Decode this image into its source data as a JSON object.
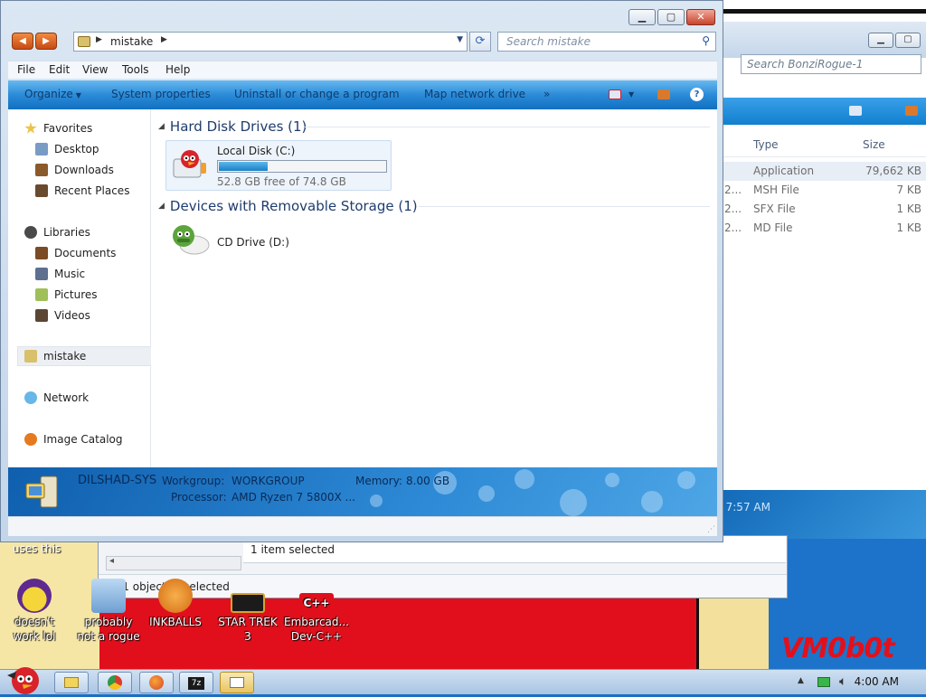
{
  "desktop": {
    "uses_this": "uses this",
    "watermark": "VM0b0t",
    "icons": [
      {
        "label": "doesn't work lol",
        "glyph": "yahoo-messenger-icon",
        "color": "#5f2a8f"
      },
      {
        "label": "probably not a rogue",
        "glyph": "monitor-install-icon",
        "color": "#7fb3e0"
      },
      {
        "label": "INKBALLS",
        "glyph": "inkball-icon",
        "color": "#f08a2a"
      },
      {
        "label": "STAR TREK 3",
        "glyph": "star-wars-logo-icon",
        "color": "#d8a22a"
      },
      {
        "label": "Embarcad... Dev-C++",
        "glyph": "cpp-icon",
        "color": "#e10f1c"
      }
    ]
  },
  "back_window": {
    "search_placeholder": "Search BonziRogue-1",
    "columns": {
      "type": "Type",
      "size": "Size"
    },
    "rows": [
      {
        "prefix": "",
        "type": "Application",
        "size": "79,662 KB"
      },
      {
        "prefix": "2...",
        "type": "MSH File",
        "size": "7 KB"
      },
      {
        "prefix": "2...",
        "type": "SFX File",
        "size": "1 KB"
      },
      {
        "prefix": "2...",
        "type": "MD File",
        "size": "1 KB"
      }
    ],
    "status_time": ", 7:57 AM"
  },
  "bottom_window": {
    "selected_text": "1 item selected",
    "status_text": "0 / 1 object(s) selected"
  },
  "window": {
    "address": {
      "crumb": "mistake"
    },
    "search_placeholder": "Search mistake",
    "menu": [
      "File",
      "Edit",
      "View",
      "Tools",
      "Help"
    ],
    "toolbar": {
      "organize": "Organize",
      "system_properties": "System properties",
      "uninstall": "Uninstall or change a program",
      "map_drive": "Map network drive",
      "more": "»"
    },
    "nav": {
      "favorites": "Favorites",
      "desktop": "Desktop",
      "downloads": "Downloads",
      "recent": "Recent Places",
      "libraries": "Libraries",
      "documents": "Documents",
      "music": "Music",
      "pictures": "Pictures",
      "videos": "Videos",
      "mistake": "mistake",
      "network": "Network",
      "image_catalog": "Image Catalog"
    },
    "groups": {
      "hdd": "Hard Disk Drives (1)",
      "removable": "Devices with Removable Storage (1)"
    },
    "drives": {
      "c_name": "Local Disk (C:)",
      "c_free": "52.8 GB free of 74.8 GB",
      "c_used_fraction": 0.294,
      "d_name": "CD Drive (D:)"
    },
    "details": {
      "computer": "DILSHAD-SYS",
      "workgroup_label": "Workgroup:",
      "workgroup": "WORKGROUP",
      "memory_label": "Memory:",
      "memory": "8.00 GB",
      "processor_label": "Processor:",
      "processor": "AMD Ryzen 7 5800X ..."
    }
  },
  "taskbar": {
    "clock": "4:00 AM",
    "buttons": [
      "explorer-icon",
      "chrome-icon",
      "firefox-icon",
      "7zip-icon",
      "window-icon"
    ]
  }
}
